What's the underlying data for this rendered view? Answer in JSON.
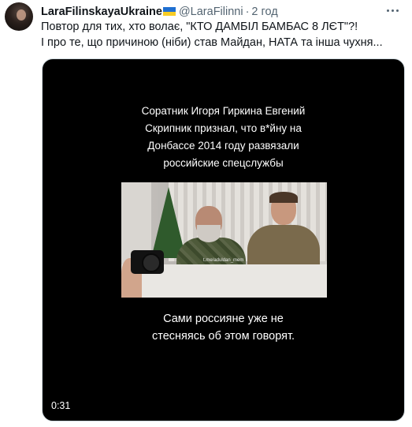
{
  "tweet": {
    "display_name": "LaraFilinskayaUkraine",
    "flag_icon": "ukraine-flag-icon",
    "handle": "@LaraFilinni",
    "separator": "·",
    "time": "2 год",
    "text_lines": [
      "Повтор для тих, хто волає, \"КТО ДАМБІЛ БАМБАС 8 ЛЄТ\"?!",
      "І про те, що причиною (ніби) став Майдан, НАТА та інша чухня..."
    ]
  },
  "video": {
    "caption_top_lines": [
      "Соратник Игоря Гиркина Евгений",
      "Скрипник признал, что в*йну на",
      "Донбассе  2014 году развязали",
      "российские спецслужбы"
    ],
    "watermark": "t.me/aduldan_mem",
    "caption_bottom_lines": [
      "Сами россияне уже не",
      "стесняясь об этом говорят."
    ],
    "duration": "0:31"
  },
  "colors": {
    "text_primary": "#0f1419",
    "text_secondary": "#536471",
    "video_background": "#000000",
    "flag_blue": "#1f6fd1",
    "flag_yellow": "#f7cc25"
  }
}
